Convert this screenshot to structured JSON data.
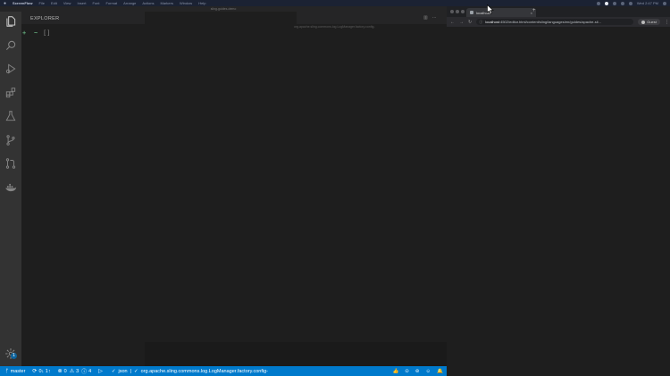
{
  "menubar": {
    "app_name": "ScreenFlow",
    "items": [
      "File",
      "Edit",
      "View",
      "Insert",
      "Font",
      "Format",
      "Arrange",
      "Actions",
      "Markers",
      "Window",
      "Help"
    ],
    "clock": "Wed 2:47 PM"
  },
  "titlebar": {
    "title": "sling-guides-demo"
  },
  "sidebar": {
    "title": "EXPLORER"
  },
  "breadcrumb": {
    "text": "org.apache.sling.commons.log.LogManager.factory.config-"
  },
  "editor": {
    "line1_marker1": "+",
    "line1_marker2": "~",
    "line1_bracket": "[]"
  },
  "activitybar": {
    "icons": [
      "explorer-icon",
      "search-icon",
      "run-debug-icon",
      "extensions-icon",
      "test-flask-icon",
      "source-control-icon",
      "pull-request-icon",
      "docker-icon",
      "settings-gear-icon"
    ],
    "settings_badge": "1"
  },
  "statusbar": {
    "branch": "master",
    "sync": "0↓ 1↑",
    "errors": "0",
    "warnings": "3",
    "info": "4",
    "check": "✓",
    "language": "json",
    "separator": "|",
    "schema": "org.apache.sling.commons.log.LogManager.factory.config-"
  },
  "browser": {
    "tab_title": "localhost",
    "tab_close": "×",
    "new_tab": "+",
    "url_host": "localhost",
    "url_path": ":4502/editor.html/content/sling/languages/en/guides/apache-sli...",
    "profile": "Guest",
    "more": "⋮"
  },
  "colors": {
    "accent": "#007acc",
    "activity_bar": "#333333",
    "sidebar": "#252526",
    "editor": "#1e1e1e",
    "git_added": "#73c991"
  }
}
